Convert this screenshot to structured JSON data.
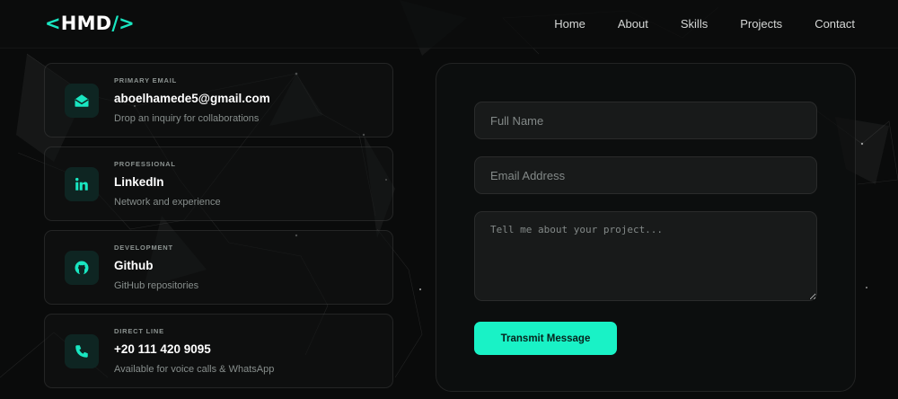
{
  "logo": {
    "open": "<",
    "text": "HMD",
    "close": "/>"
  },
  "nav": {
    "links": [
      {
        "label": "Home"
      },
      {
        "label": "About"
      },
      {
        "label": "Skills"
      },
      {
        "label": "Projects"
      },
      {
        "label": "Contact"
      }
    ]
  },
  "cards": [
    {
      "icon": "mail-open-icon",
      "tag": "PRIMARY EMAIL",
      "value": "aboelhamede5@gmail.com",
      "sub": "Drop an inquiry for collaborations"
    },
    {
      "icon": "linkedin-icon",
      "tag": "PROFESSIONAL",
      "value": "LinkedIn",
      "sub": "Network and experience"
    },
    {
      "icon": "github-icon",
      "tag": "DEVELOPMENT",
      "value": "Github",
      "sub": "GitHub repositories"
    },
    {
      "icon": "phone-icon",
      "tag": "DIRECT LINE",
      "value": "+20 111 420 9095",
      "sub": "Available for voice calls & WhatsApp"
    }
  ],
  "form": {
    "name_placeholder": "Full Name",
    "email_placeholder": "Email Address",
    "message_placeholder": "Tell me about your project...",
    "submit_label": "Transmit Message"
  },
  "colors": {
    "accent": "#19f2c6",
    "background": "#0a0b0b",
    "icon_tile": "#0e2522"
  }
}
